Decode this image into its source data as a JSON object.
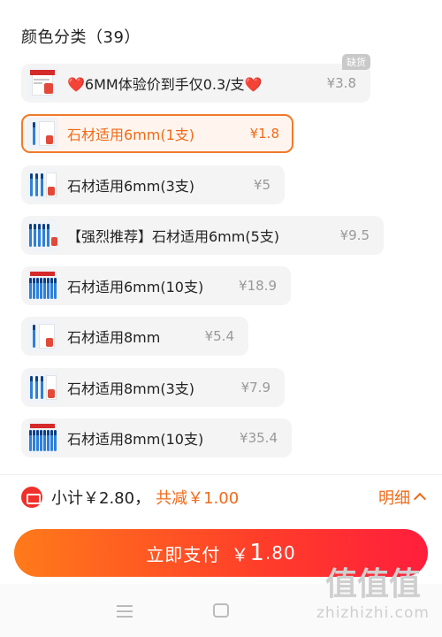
{
  "header": {
    "title": "颜色分类（39）"
  },
  "variants": [
    {
      "label_heart_left": "❤️",
      "label": "6MM体验价到手仅0.3/支",
      "label_heart_right": "❤️",
      "price": "¥3.8",
      "badge": "缺货",
      "state": "sold-out",
      "thumb": "promo"
    },
    {
      "label": "石材适用6mm(1支)",
      "price": "¥1.8",
      "state": "selected",
      "thumb": "pens-1"
    },
    {
      "label": "石材适用6mm(3支)",
      "price": "¥5",
      "state": "normal",
      "thumb": "pens-3"
    },
    {
      "label": "【强烈推荐】石材适用6mm(5支)",
      "price": "¥9.5",
      "state": "normal",
      "thumb": "pens-5"
    },
    {
      "label": "石材适用6mm(10支)",
      "price": "¥18.9",
      "state": "normal",
      "thumb": "pens-10"
    },
    {
      "label": "石材适用8mm",
      "price": "¥5.4",
      "state": "normal",
      "thumb": "pens-1"
    },
    {
      "label": "石材适用8mm(3支)",
      "price": "¥7.9",
      "state": "normal",
      "thumb": "pens-3"
    },
    {
      "label": "石材适用8mm(10支)",
      "price": "¥35.4",
      "state": "normal",
      "thumb": "pens-10"
    }
  ],
  "summary": {
    "subtotal": "小计￥2.80，",
    "discount": "共减￥1.00",
    "details_label": "明细",
    "coupon_icon": "coupon-ticket-icon"
  },
  "pay_button": {
    "label": "立即支付",
    "currency": "￥",
    "amount_int": "1",
    "amount_dec": ".80"
  },
  "nav": {
    "menu_icon": "menu-icon",
    "home_icon": "home-icon"
  },
  "watermark": {
    "chars": "值值值",
    "url": "zhizhizhi.com"
  },
  "colors": {
    "accent": "#f06a1a",
    "pay_gradient_start": "#ff7a1a",
    "pay_gradient_end": "#ff1e3c",
    "heart": "#e52a2a"
  }
}
